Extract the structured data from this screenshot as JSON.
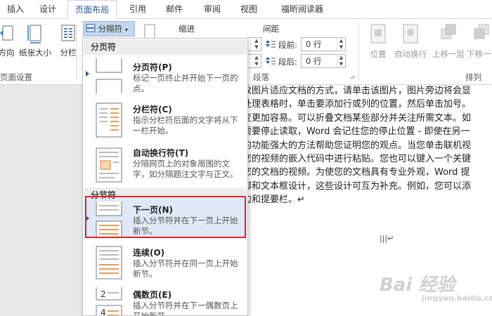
{
  "tabs": [
    {
      "label": "插入"
    },
    {
      "label": "设计"
    },
    {
      "label": "页面布局"
    },
    {
      "label": "引用"
    },
    {
      "label": "邮件"
    },
    {
      "label": "审阅"
    },
    {
      "label": "视图"
    },
    {
      "label": "福昕阅读器"
    }
  ],
  "ribbon": {
    "direction_label": "方向",
    "paper_size_label": "纸张大小",
    "columns_label": "分栏",
    "breaks_label": "分隔符",
    "page_setup_group": "页面设置",
    "indent_label": "缩进",
    "spacing_label": "间距",
    "before_label": "段前:",
    "before_value": "0 行",
    "after_label": "段后:",
    "after_value": "0 行",
    "paragraph_group": "段落",
    "position_label": "位置",
    "wrap_label": "自动换行",
    "bring_forward_label": "上移一层",
    "send_backward_label": "下移一",
    "arrange_group": "排列"
  },
  "menu": {
    "page_breaks_header": "分页符",
    "section_breaks_header": "分节符",
    "items": [
      {
        "title": "分页符(P)",
        "desc": "标记一页终止并开始下一页的点。"
      },
      {
        "title": "分栏符(C)",
        "desc": "指示分栏符后面的文字将从下一栏开始。"
      },
      {
        "title": "自动换行符(T)",
        "desc": "分隔网页上的对象周围的文字，如分隔题注文字与正文。"
      },
      {
        "title": "下一页(N)",
        "desc": "插入分节符并在下一页上开始新节。"
      },
      {
        "title": "连续(O)",
        "desc": "插入分节符并在同一页上开始新节。"
      },
      {
        "title": "偶数页(E)",
        "desc": "插入分节符并在下一偶数页上开始新节"
      }
    ]
  },
  "document": {
    "lines": [
      "改图片适应文档的方式，请单击该图片，图片旁边将会显",
      "处理表格时，单击要添加行或列的位置，然后单击加号。",
      "变更加容易。可以折叠文档某些部分并关注所需文本。如",
      "需要停止读取，Word 会记住您的停止位置 - 即使在另一",
      "的功能强大的方法帮助您证明您的观点。当您单击联机视",
      "您的视频的嵌入代码中进行粘贴。您也可以键入一个关键",
      "您的文档的视频。为使您的文档具有专业外观，Word 提",
      "脚和文本框设计，这些设计可互为补充。例如，您可以添",
      "边和提要栏。↵"
    ],
    "cursor_mark": "|||↵"
  },
  "watermark": {
    "text": "Bai 经验",
    "sub": "jingyan.baidu.com"
  },
  "colors": {
    "accent": "#2b579a",
    "highlight": "#e0262b",
    "selected_bg": "#dfe8f6"
  }
}
